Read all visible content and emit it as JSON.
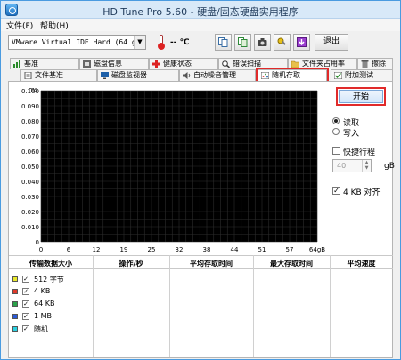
{
  "window": {
    "title": "HD Tune Pro 5.60 - 硬盘/固态硬盘实用程序"
  },
  "menu": [
    {
      "label": "文件(F)"
    },
    {
      "label": "帮助(H)"
    }
  ],
  "toolbar": {
    "drive": "VMware Virtual IDE Hard (64 gB)",
    "temperature": "-- ℃",
    "buttons": [
      {
        "name": "copy-info-icon"
      },
      {
        "name": "copy-screenshot-icon"
      },
      {
        "name": "camera-icon"
      },
      {
        "name": "options-icon"
      },
      {
        "name": "save-icon"
      }
    ],
    "exit_label": "退出"
  },
  "tabs_row1": [
    {
      "label": "基准"
    },
    {
      "label": "磁盘信息"
    },
    {
      "label": "健康状态"
    },
    {
      "label": "错误扫描"
    },
    {
      "label": "文件夹占用率"
    },
    {
      "label": "擦除"
    }
  ],
  "tabs_row2": [
    {
      "label": "文件基准"
    },
    {
      "label": "磁盘监视器"
    },
    {
      "label": "自动噪音管理"
    },
    {
      "label": "随机存取"
    },
    {
      "label": "附加测试"
    }
  ],
  "chart_data": {
    "type": "scatter",
    "y_unit": "ms",
    "x_unit": "gB",
    "y_ticks": [
      "0.100",
      "0.090",
      "0.080",
      "0.070",
      "0.060",
      "0.050",
      "0.040",
      "0.030",
      "0.020",
      "0.010",
      "0"
    ],
    "x_ticks": [
      "0",
      "6",
      "12",
      "19",
      "25",
      "32",
      "38",
      "44",
      "51",
      "57",
      "64gB"
    ],
    "ylim": [
      0,
      0.1
    ],
    "xlim": [
      0,
      64
    ],
    "grid": true,
    "series": []
  },
  "controls": {
    "start_label": "开始",
    "read_label": "读取",
    "write_label": "写入",
    "read_selected": true,
    "short_stroke_label": "快捷行程",
    "short_stroke_checked": false,
    "short_stroke_value": "40",
    "short_stroke_unit": "gB",
    "align_label": "4 KB 对齐",
    "align_checked": true
  },
  "table": {
    "headers": [
      "传输数据大小",
      "操作/秒",
      "平均存取时间",
      "最大存取时间",
      "平均速度"
    ],
    "rows": [
      {
        "label": "512 字节",
        "color": "#e8e82a",
        "checked": true
      },
      {
        "label": "4 KB",
        "color": "#e03a2a",
        "checked": true
      },
      {
        "label": "64 KB",
        "color": "#2aa24a",
        "checked": true
      },
      {
        "label": "1 MB",
        "color": "#2a5ad8",
        "checked": true
      },
      {
        "label": "随机",
        "color": "#2ad0e0",
        "checked": true
      }
    ]
  }
}
